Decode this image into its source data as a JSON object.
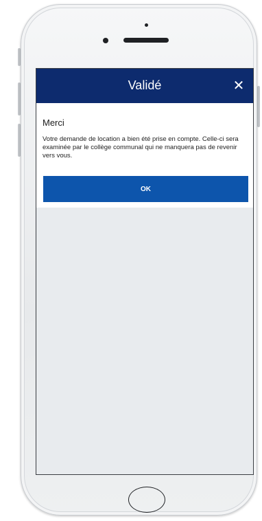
{
  "dialog": {
    "title": "Validé",
    "close_icon": "close-icon",
    "close_glyph": "✕",
    "heading": "Merci",
    "message": "Votre demande de location a bien été prise en compte. Celle-ci sera examinée par le collège communal qui ne manquera pas de revenir vers vous.",
    "ok_label": "OK"
  },
  "colors": {
    "header_bg": "#0d2b6e",
    "button_bg": "#0d55ac",
    "screen_bg": "#e8ebee"
  }
}
